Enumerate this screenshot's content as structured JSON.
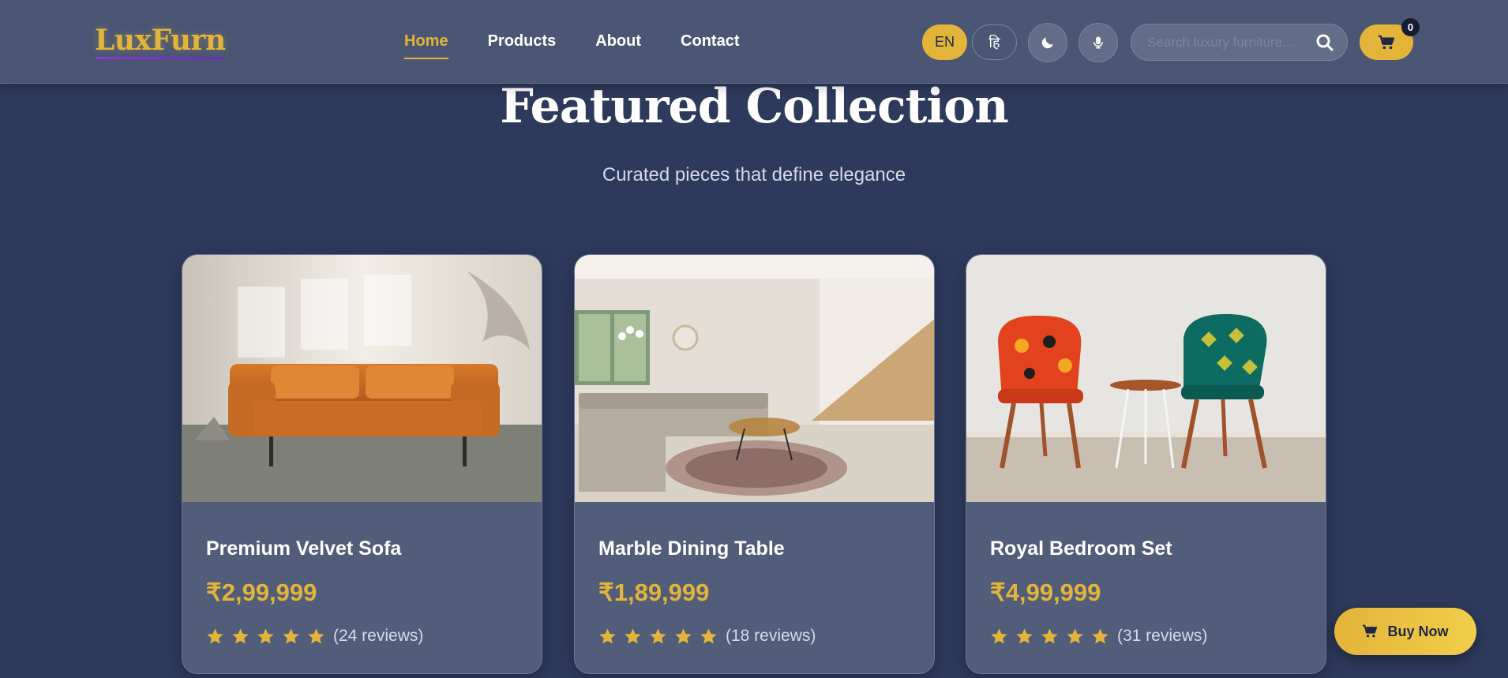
{
  "brand": {
    "name": "LuxFurn",
    "accent_color": "#e3b43a"
  },
  "nav": {
    "items": [
      {
        "label": "Home",
        "active": true
      },
      {
        "label": "Products",
        "active": false
      },
      {
        "label": "About",
        "active": false
      },
      {
        "label": "Contact",
        "active": false
      }
    ]
  },
  "language": {
    "en_label": "EN",
    "hi_label": "हि",
    "selected": "EN"
  },
  "toolbar": {
    "theme_icon": "moon-icon",
    "voice_icon": "microphone-icon"
  },
  "search": {
    "placeholder": "Search luxury furniture...",
    "value": "",
    "icon": "search-icon"
  },
  "cart": {
    "count": "0",
    "icon": "cart-icon"
  },
  "featured": {
    "title": "Featured Collection",
    "subtitle": "Curated pieces that define elegance",
    "products": [
      {
        "name": "Premium Velvet Sofa",
        "price": "₹2,99,999",
        "rating": 5,
        "reviews": "(24 reviews)",
        "image": "orange leather sofa in sunlit room"
      },
      {
        "name": "Marble Dining Table",
        "price": "₹1,89,999",
        "rating": 5,
        "reviews": "(18 reviews)",
        "image": "modern living room with sectional sofa"
      },
      {
        "name": "Royal Bedroom Set",
        "price": "₹4,99,999",
        "rating": 5,
        "reviews": "(31 reviews)",
        "image": "two patterned accent chairs with side table"
      }
    ]
  },
  "cta": {
    "label": "Buy Now",
    "icon": "cart-icon"
  }
}
